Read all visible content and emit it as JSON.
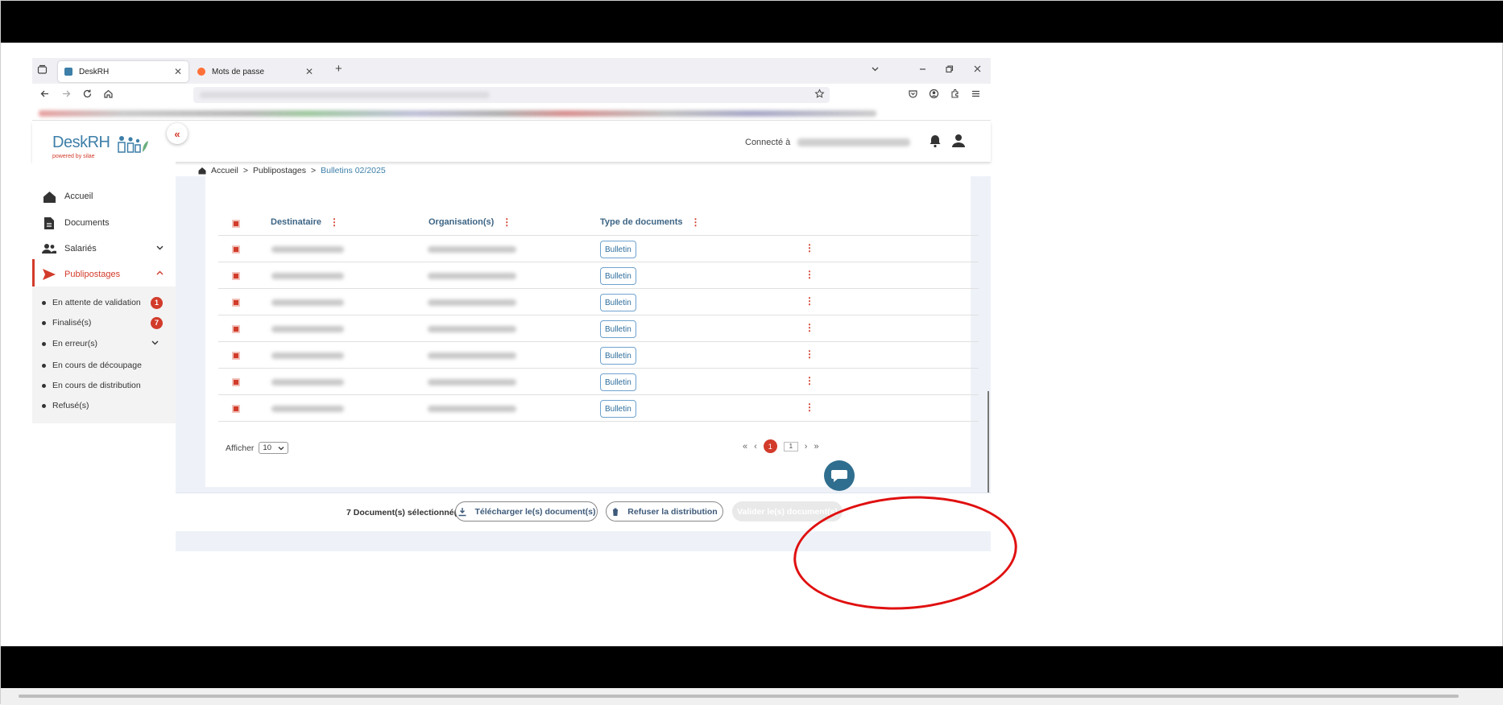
{
  "browser": {
    "tabs": [
      {
        "label": "DeskRH",
        "active": true
      },
      {
        "label": "Mots de passe",
        "active": false
      }
    ],
    "new_tab": "+"
  },
  "header": {
    "logo_main": "DeskRH",
    "logo_sub": "powered by silae",
    "connected_label": "Connecté à"
  },
  "sidebar": {
    "items": [
      {
        "label": "Accueil",
        "icon": "home-icon"
      },
      {
        "label": "Documents",
        "icon": "document-icon"
      },
      {
        "label": "Salariés",
        "icon": "people-icon"
      },
      {
        "label": "Publipostages",
        "icon": "send-icon"
      }
    ],
    "submenu": [
      {
        "label": "En attente de validation",
        "badge": "1"
      },
      {
        "label": "Finalisé(s)",
        "badge": "7"
      },
      {
        "label": "En erreur(s)",
        "badge": ""
      },
      {
        "label": "En cours de découpage",
        "badge": ""
      },
      {
        "label": "En cours de distribution",
        "badge": ""
      },
      {
        "label": "Refusé(s)",
        "badge": ""
      }
    ]
  },
  "breadcrumb": {
    "home": "Accueil",
    "sep": ">",
    "level1": "Publipostages",
    "current": "Bulletins 02/2025"
  },
  "table": {
    "columns": [
      "Destinataire",
      "Organisation(s)",
      "Type de documents"
    ],
    "rows": [
      {
        "type": "Bulletin"
      },
      {
        "type": "Bulletin"
      },
      {
        "type": "Bulletin"
      },
      {
        "type": "Bulletin"
      },
      {
        "type": "Bulletin"
      },
      {
        "type": "Bulletin"
      },
      {
        "type": "Bulletin"
      }
    ]
  },
  "pagination": {
    "show_label": "Afficher",
    "page_size": "10",
    "current_page": "1",
    "page_input": "1"
  },
  "actions": {
    "selected_count": "7 Document(s) sélectionné(s)",
    "download": "Télécharger le(s) document(s)",
    "refuse": "Refuser la distribution",
    "validate": "Valider le(s) document(s)"
  },
  "colors": {
    "accent": "#d23b2a",
    "brand": "#3d7fa8",
    "annotation": "#e01010"
  }
}
